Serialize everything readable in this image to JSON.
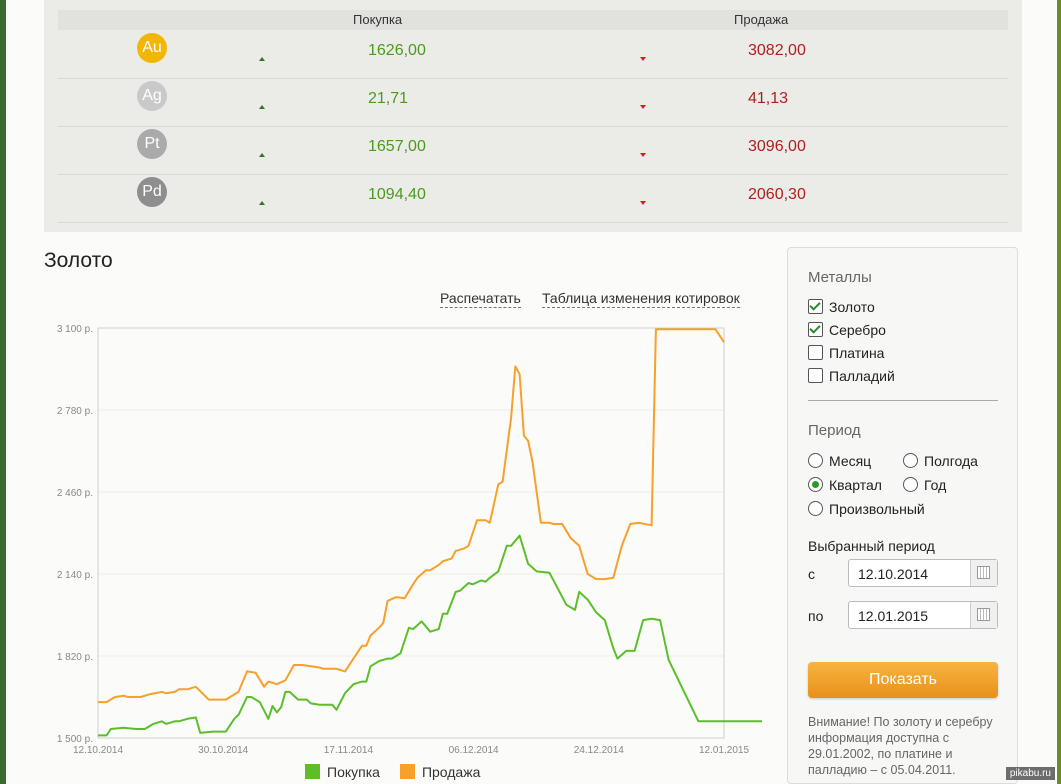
{
  "rates": {
    "header": {
      "buy": "Покупка",
      "sell": "Продажа"
    },
    "rows": [
      {
        "symbol": "Au",
        "color": "#f2b705",
        "buy": "1626,00",
        "sell": "3082,00"
      },
      {
        "symbol": "Ag",
        "color": "#c9c9c9",
        "buy": "21,71",
        "sell": "41,13"
      },
      {
        "symbol": "Pt",
        "color": "#aaaaaa",
        "buy": "1657,00",
        "sell": "3096,00"
      },
      {
        "symbol": "Pd",
        "color": "#8e8e8e",
        "buy": "1094,40",
        "sell": "2060,30"
      }
    ]
  },
  "section_title": "Золото",
  "links": {
    "print": "Распечатать",
    "table": "Таблица изменения котировок"
  },
  "chart_data": {
    "type": "line",
    "ylim": [
      1500,
      3100
    ],
    "y_ticks": [
      "3 100 р.",
      "2 780 р.",
      "2 460 р.",
      "2 140 р.",
      "1 820 р.",
      "1 500 р."
    ],
    "x_ticks": [
      "12.10.2014",
      "30.10.2014",
      "17.11.2014",
      "06.12.2014",
      "24.12.2014",
      "12.01.2015"
    ],
    "x_range_days": 92,
    "series": [
      {
        "name": "Покупка",
        "color": "#5cbf2a",
        "points": [
          [
            0,
            1510
          ],
          [
            2,
            1510
          ],
          [
            3,
            1535
          ],
          [
            6,
            1540
          ],
          [
            9,
            1535
          ],
          [
            11,
            1535
          ],
          [
            13,
            1555
          ],
          [
            15,
            1565
          ],
          [
            16,
            1555
          ],
          [
            18,
            1565
          ],
          [
            19,
            1565
          ],
          [
            21,
            1575
          ],
          [
            23,
            1580
          ],
          [
            24,
            1520
          ],
          [
            27,
            1525
          ],
          [
            28,
            1525
          ],
          [
            30,
            1525
          ],
          [
            32,
            1575
          ],
          [
            33,
            1590
          ],
          [
            35,
            1660
          ],
          [
            36,
            1660
          ],
          [
            38,
            1640
          ],
          [
            40,
            1575
          ],
          [
            41,
            1625
          ],
          [
            42,
            1600
          ],
          [
            43,
            1620
          ],
          [
            44,
            1680
          ],
          [
            45,
            1680
          ],
          [
            47,
            1650
          ],
          [
            49,
            1650
          ],
          [
            50,
            1635
          ],
          [
            52,
            1630
          ],
          [
            53,
            1630
          ],
          [
            55,
            1630
          ],
          [
            56,
            1610
          ],
          [
            58,
            1675
          ],
          [
            60,
            1710
          ],
          [
            62,
            1720
          ],
          [
            63,
            1720
          ],
          [
            64,
            1780
          ],
          [
            66,
            1800
          ],
          [
            68,
            1810
          ],
          [
            69,
            1810
          ],
          [
            71,
            1830
          ],
          [
            73,
            1930
          ],
          [
            74,
            1925
          ],
          [
            76,
            1955
          ],
          [
            78,
            1915
          ],
          [
            80,
            1925
          ],
          [
            81,
            1985
          ],
          [
            82,
            1985
          ],
          [
            84,
            2070
          ],
          [
            85,
            2075
          ],
          [
            87,
            2105
          ],
          [
            88,
            2100
          ],
          [
            90,
            2115
          ],
          [
            91,
            2110
          ],
          [
            92,
            2125
          ],
          [
            94,
            2150
          ],
          [
            96,
            2250
          ],
          [
            97,
            2250
          ],
          [
            99,
            2290
          ],
          [
            101,
            2180
          ],
          [
            103,
            2150
          ],
          [
            106,
            2145
          ],
          [
            110,
            2020
          ],
          [
            112,
            2000
          ],
          [
            113,
            2070
          ],
          [
            115,
            2040
          ],
          [
            117,
            1990
          ],
          [
            119,
            1960
          ],
          [
            121,
            1850
          ],
          [
            122,
            1810
          ],
          [
            124,
            1840
          ],
          [
            126,
            1840
          ],
          [
            128,
            1960
          ],
          [
            130,
            1965
          ],
          [
            132,
            1960
          ],
          [
            134,
            1805
          ],
          [
            141,
            1565
          ],
          [
            158,
            1565
          ]
        ]
      },
      {
        "name": "Продажа",
        "color": "#f7a02a",
        "points": [
          [
            0,
            1640
          ],
          [
            2,
            1640
          ],
          [
            4,
            1660
          ],
          [
            6,
            1665
          ],
          [
            7,
            1660
          ],
          [
            9,
            1660
          ],
          [
            10,
            1660
          ],
          [
            12,
            1670
          ],
          [
            15,
            1680
          ],
          [
            16,
            1675
          ],
          [
            18,
            1680
          ],
          [
            19,
            1690
          ],
          [
            21,
            1690
          ],
          [
            23,
            1700
          ],
          [
            26,
            1650
          ],
          [
            28,
            1650
          ],
          [
            30,
            1650
          ],
          [
            33,
            1680
          ],
          [
            35,
            1760
          ],
          [
            37,
            1755
          ],
          [
            39,
            1700
          ],
          [
            40,
            1720
          ],
          [
            42,
            1710
          ],
          [
            44,
            1725
          ],
          [
            46,
            1785
          ],
          [
            48,
            1785
          ],
          [
            50,
            1780
          ],
          [
            52,
            1775
          ],
          [
            53,
            1770
          ],
          [
            56,
            1770
          ],
          [
            58,
            1760
          ],
          [
            60,
            1810
          ],
          [
            62,
            1860
          ],
          [
            63,
            1860
          ],
          [
            64,
            1900
          ],
          [
            66,
            1930
          ],
          [
            67,
            1950
          ],
          [
            68,
            2035
          ],
          [
            70,
            2050
          ],
          [
            72,
            2045
          ],
          [
            74,
            2100
          ],
          [
            75,
            2125
          ],
          [
            77,
            2155
          ],
          [
            78,
            2155
          ],
          [
            80,
            2175
          ],
          [
            81,
            2190
          ],
          [
            83,
            2200
          ],
          [
            84,
            2230
          ],
          [
            86,
            2240
          ],
          [
            87,
            2250
          ],
          [
            89,
            2350
          ],
          [
            91,
            2350
          ],
          [
            92,
            2340
          ],
          [
            94,
            2490
          ],
          [
            95,
            2500
          ],
          [
            97,
            2750
          ],
          [
            98,
            2950
          ],
          [
            99,
            2920
          ],
          [
            100,
            2680
          ],
          [
            101,
            2660
          ],
          [
            102,
            2580
          ],
          [
            104,
            2340
          ],
          [
            106,
            2340
          ],
          [
            107,
            2335
          ],
          [
            109,
            2335
          ],
          [
            111,
            2280
          ],
          [
            113,
            2250
          ],
          [
            115,
            2140
          ],
          [
            117,
            2120
          ],
          [
            119,
            2120
          ],
          [
            121,
            2125
          ],
          [
            123,
            2250
          ],
          [
            125,
            2335
          ],
          [
            127,
            2340
          ],
          [
            130,
            2330
          ],
          [
            131,
            3095
          ],
          [
            140,
            3095
          ],
          [
            145,
            3095
          ],
          [
            147,
            3045
          ]
        ]
      }
    ],
    "x_data_max": 147
  },
  "legend": [
    {
      "label": "Покупка",
      "color": "#5cbf2a"
    },
    {
      "label": "Продажа",
      "color": "#f7a02a"
    }
  ],
  "panel": {
    "metals_title": "Металлы",
    "metals": [
      {
        "label": "Золото",
        "checked": true
      },
      {
        "label": "Серебро",
        "checked": true
      },
      {
        "label": "Платина",
        "checked": false
      },
      {
        "label": "Палладий",
        "checked": false
      }
    ],
    "period_title": "Период",
    "periods": [
      {
        "label": "Месяц",
        "selected": false
      },
      {
        "label": "Полгода",
        "selected": false
      },
      {
        "label": "Квартал",
        "selected": true
      },
      {
        "label": "Год",
        "selected": false
      },
      {
        "label": "Произвольный",
        "selected": false
      }
    ],
    "selected_period_title": "Выбранный период",
    "from_label": "с",
    "from_value": "12.10.2014",
    "to_label": "по",
    "to_value": "12.01.2015",
    "show_button": "Показать",
    "note": "Внимание! По золоту и серебру информация доступна с 29.01.2002, по платине и палладию – с 05.04.2011."
  },
  "watermark": "pikabu.ru"
}
